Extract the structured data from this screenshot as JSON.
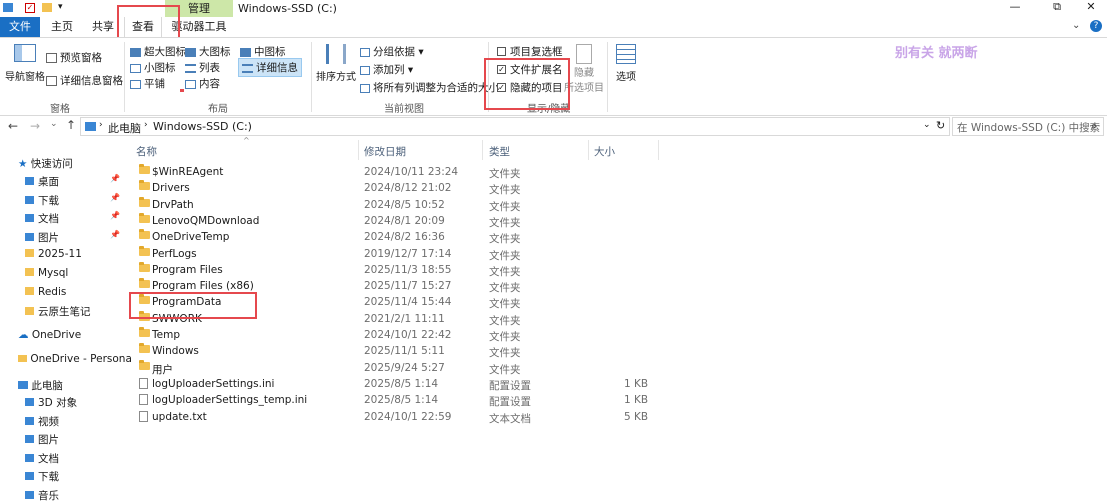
{
  "window": {
    "title": "Windows-SSD (C:)",
    "context_tab": "管理",
    "min_label": "—",
    "max_label": "⧉",
    "close_label": "✕"
  },
  "ribbon_tabs": {
    "file": "文件",
    "home": "主页",
    "share": "共享",
    "view": "查看",
    "drive_tools": "驱动器工具",
    "help_icon": "?"
  },
  "ribbon": {
    "pane_group": {
      "nav_pane": "导航窗格",
      "preview_pane": "预览窗格",
      "details_pane": "详细信息窗格",
      "label": "窗格"
    },
    "layout_group": {
      "xlarge": "超大图标",
      "large": "大图标",
      "medium": "中图标",
      "small": "小图标",
      "list": "列表",
      "details": "详细信息",
      "tiles": "平铺",
      "content": "内容",
      "label": "布局"
    },
    "view_group": {
      "sort": "排序方式",
      "group_by": "分组依据",
      "add_columns": "添加列",
      "fit_columns": "将所有列调整为合适的大小",
      "label": "当前视图"
    },
    "show_hide_group": {
      "item_checkboxes": "项目复选框",
      "extensions": "文件扩展名",
      "hidden_items": "隐藏的项目",
      "hide_selected_1": "隐藏",
      "hide_selected_2": "所选项目",
      "options": "选项",
      "label": "显示/隐藏",
      "item_checkboxes_checked": false,
      "extensions_checked": true,
      "hidden_items_checked": true
    },
    "watermark": "别有关 就两断"
  },
  "address": {
    "crumb_pc": "此电脑",
    "crumb_drive": "Windows-SSD (C:)",
    "search_placeholder": "在 Windows-SSD (C:) 中搜索"
  },
  "nav": {
    "quick_access": "快速访问",
    "items": [
      {
        "label": "桌面",
        "pinned": true
      },
      {
        "label": "下载",
        "pinned": true
      },
      {
        "label": "文档",
        "pinned": true
      },
      {
        "label": "图片",
        "pinned": true
      },
      {
        "label": "2025-11",
        "pinned": false
      },
      {
        "label": "Mysql",
        "pinned": false
      },
      {
        "label": "Redis",
        "pinned": false
      },
      {
        "label": "云原生笔记",
        "pinned": false
      }
    ],
    "onedrive": "OneDrive",
    "onedrive_personal": "OneDrive - Persona",
    "this_pc": "此电脑",
    "pc_items": [
      "3D 对象",
      "视频",
      "图片",
      "文档",
      "下载",
      "音乐"
    ],
    "pin_glyph": "📌"
  },
  "columns": {
    "name": "名称",
    "modified": "修改日期",
    "type": "类型",
    "size": "大小"
  },
  "files": [
    {
      "name": "$WinREAgent",
      "date": "2024/10/11 23:24",
      "type": "文件夹",
      "size": "",
      "kind": "folder"
    },
    {
      "name": "Drivers",
      "date": "2024/8/12 21:02",
      "type": "文件夹",
      "size": "",
      "kind": "folder"
    },
    {
      "name": "DrvPath",
      "date": "2024/8/5 10:52",
      "type": "文件夹",
      "size": "",
      "kind": "folder"
    },
    {
      "name": "LenovoQMDownload",
      "date": "2024/8/1 20:09",
      "type": "文件夹",
      "size": "",
      "kind": "folder"
    },
    {
      "name": "OneDriveTemp",
      "date": "2024/8/2 16:36",
      "type": "文件夹",
      "size": "",
      "kind": "folder"
    },
    {
      "name": "PerfLogs",
      "date": "2019/12/7 17:14",
      "type": "文件夹",
      "size": "",
      "kind": "folder"
    },
    {
      "name": "Program Files",
      "date": "2025/11/3 18:55",
      "type": "文件夹",
      "size": "",
      "kind": "folder"
    },
    {
      "name": "Program Files (x86)",
      "date": "2025/11/7 15:27",
      "type": "文件夹",
      "size": "",
      "kind": "folder"
    },
    {
      "name": "ProgramData",
      "date": "2025/11/4 15:44",
      "type": "文件夹",
      "size": "",
      "kind": "folder"
    },
    {
      "name": "SWWORK",
      "date": "2021/2/1 11:11",
      "type": "文件夹",
      "size": "",
      "kind": "folder"
    },
    {
      "name": "Temp",
      "date": "2024/10/1 22:42",
      "type": "文件夹",
      "size": "",
      "kind": "folder"
    },
    {
      "name": "Windows",
      "date": "2025/11/1 5:11",
      "type": "文件夹",
      "size": "",
      "kind": "folder"
    },
    {
      "name": "用户",
      "date": "2025/9/24 5:27",
      "type": "文件夹",
      "size": "",
      "kind": "folder"
    },
    {
      "name": "logUploaderSettings.ini",
      "date": "2025/8/5 1:14",
      "type": "配置设置",
      "size": "1 KB",
      "kind": "ini"
    },
    {
      "name": "logUploaderSettings_temp.ini",
      "date": "2025/8/5 1:14",
      "type": "配置设置",
      "size": "1 KB",
      "kind": "ini"
    },
    {
      "name": "update.txt",
      "date": "2024/10/1 22:59",
      "type": "文本文档",
      "size": "5 KB",
      "kind": "txt"
    }
  ]
}
